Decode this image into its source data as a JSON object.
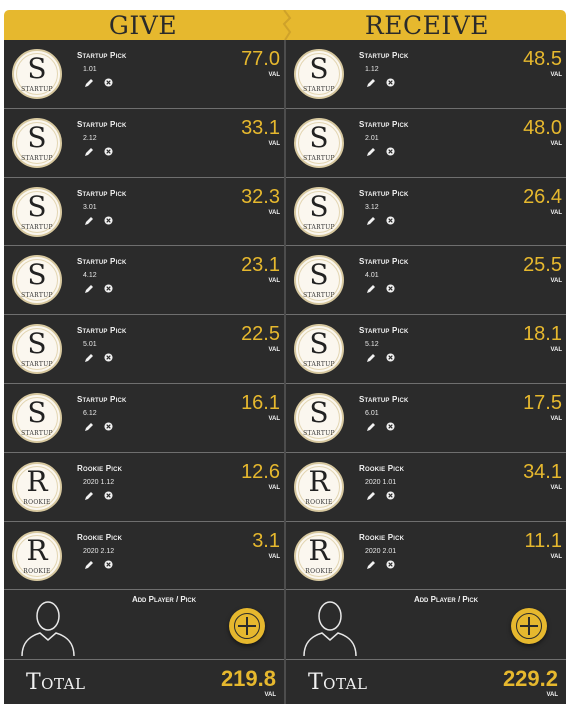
{
  "header": {
    "give_title": "Give",
    "receive_title": "Receive"
  },
  "give": {
    "picks": [
      {
        "name": "Startup Pick",
        "detail": "1.01",
        "value": "77.0",
        "val_label": "VAL",
        "avatar_letter": "S",
        "avatar_sub": "STARTUP"
      },
      {
        "name": "Startup Pick",
        "detail": "2.12",
        "value": "33.1",
        "val_label": "VAL",
        "avatar_letter": "S",
        "avatar_sub": "STARTUP"
      },
      {
        "name": "Startup Pick",
        "detail": "3.01",
        "value": "32.3",
        "val_label": "VAL",
        "avatar_letter": "S",
        "avatar_sub": "STARTUP"
      },
      {
        "name": "Startup Pick",
        "detail": "4.12",
        "value": "23.1",
        "val_label": "VAL",
        "avatar_letter": "S",
        "avatar_sub": "STARTUP"
      },
      {
        "name": "Startup Pick",
        "detail": "5.01",
        "value": "22.5",
        "val_label": "VAL",
        "avatar_letter": "S",
        "avatar_sub": "STARTUP"
      },
      {
        "name": "Startup Pick",
        "detail": "6.12",
        "value": "16.1",
        "val_label": "VAL",
        "avatar_letter": "S",
        "avatar_sub": "STARTUP"
      },
      {
        "name": "Rookie Pick",
        "detail": "2020 1.12",
        "value": "12.6",
        "val_label": "VAL",
        "avatar_letter": "R",
        "avatar_sub": "ROOKIE"
      },
      {
        "name": "Rookie Pick",
        "detail": "2020 2.12",
        "value": "3.1",
        "val_label": "VAL",
        "avatar_letter": "R",
        "avatar_sub": "ROOKIE"
      }
    ],
    "add_label": "Add Player / Pick",
    "total_label": "Total",
    "total_value": "219.8",
    "total_val_label": "VAL"
  },
  "receive": {
    "picks": [
      {
        "name": "Startup Pick",
        "detail": "1.12",
        "value": "48.5",
        "val_label": "VAL",
        "avatar_letter": "S",
        "avatar_sub": "STARTUP"
      },
      {
        "name": "Startup Pick",
        "detail": "2.01",
        "value": "48.0",
        "val_label": "VAL",
        "avatar_letter": "S",
        "avatar_sub": "STARTUP"
      },
      {
        "name": "Startup Pick",
        "detail": "3.12",
        "value": "26.4",
        "val_label": "VAL",
        "avatar_letter": "S",
        "avatar_sub": "STARTUP"
      },
      {
        "name": "Startup Pick",
        "detail": "4.01",
        "value": "25.5",
        "val_label": "VAL",
        "avatar_letter": "S",
        "avatar_sub": "STARTUP"
      },
      {
        "name": "Startup Pick",
        "detail": "5.12",
        "value": "18.1",
        "val_label": "VAL",
        "avatar_letter": "S",
        "avatar_sub": "STARTUP"
      },
      {
        "name": "Startup Pick",
        "detail": "6.01",
        "value": "17.5",
        "val_label": "VAL",
        "avatar_letter": "S",
        "avatar_sub": "STARTUP"
      },
      {
        "name": "Rookie Pick",
        "detail": "2020 1.01",
        "value": "34.1",
        "val_label": "VAL",
        "avatar_letter": "R",
        "avatar_sub": "ROOKIE"
      },
      {
        "name": "Rookie Pick",
        "detail": "2020 2.01",
        "value": "11.1",
        "val_label": "VAL",
        "avatar_letter": "R",
        "avatar_sub": "ROOKIE"
      }
    ],
    "add_label": "Add Player / Pick",
    "total_label": "Total",
    "total_value": "229.2",
    "total_val_label": "VAL"
  },
  "colors": {
    "accent": "#e6b82e",
    "panel": "#2b2b2b",
    "text": "#f2f2f2"
  },
  "icons": {
    "edit": "pencil-icon",
    "remove": "close-circle-icon",
    "add": "plus-icon",
    "placeholder": "user-silhouette-icon"
  }
}
